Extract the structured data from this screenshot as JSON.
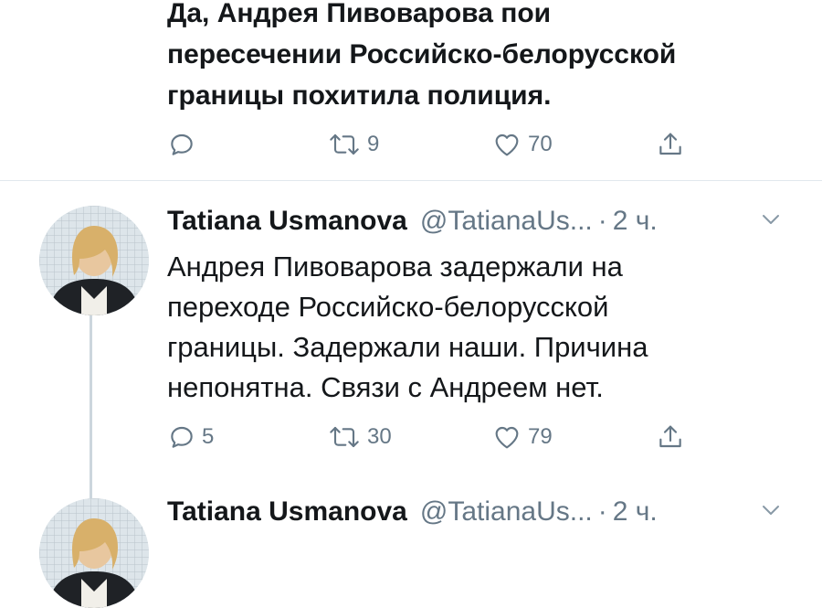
{
  "tweet_prev": {
    "lines": [
      "Да, Андрея Пивоварова пои",
      "пересечении Российско-белорусской",
      "границы похитила полиция."
    ],
    "actions": {
      "reply_count": "",
      "retweet_count": "9",
      "like_count": "70"
    }
  },
  "tweet_main": {
    "author_name": "Tatiana Usmanova",
    "handle": "@TatianaUs...",
    "separator": "·",
    "time": "2 ч.",
    "lines": [
      "Андрея Пивоварова задержали на",
      "переходе Российско-белорусской",
      "границы. Задержали наши. Причина",
      "непонятна. Связи с Андреем нет."
    ],
    "actions": {
      "reply_count": "5",
      "retweet_count": "30",
      "like_count": "79"
    }
  },
  "tweet_next": {
    "author_name": "Tatiana Usmanova",
    "handle": "@TatianaUs...",
    "separator": "·",
    "time": "2 ч."
  },
  "colors": {
    "text": "#14171a",
    "secondary": "#657786",
    "divider": "#e1e8ed",
    "thread_line": "#ccd6dd"
  },
  "icons": [
    "reply-icon",
    "retweet-icon",
    "like-icon",
    "share-icon",
    "chevron-down-icon"
  ]
}
